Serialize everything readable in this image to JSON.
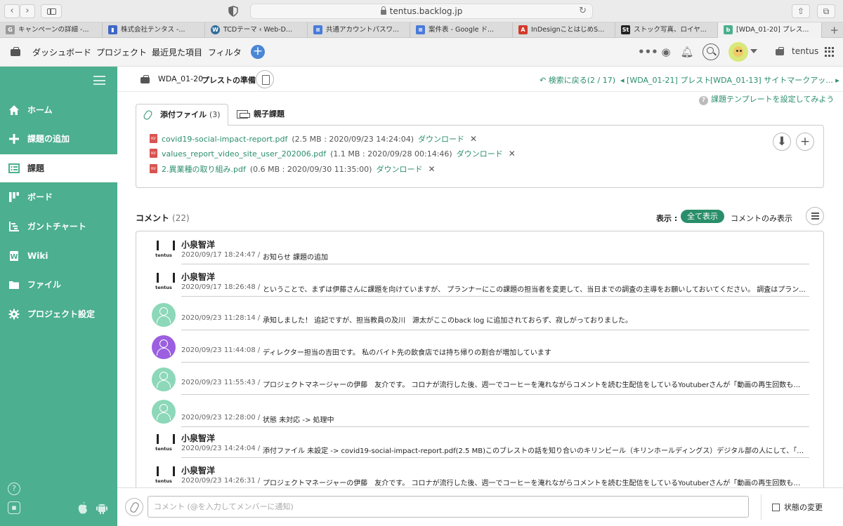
{
  "browser": {
    "url": "tentus.backlog.jp",
    "tabs": [
      {
        "label": "キャンペーンの詳細 -...",
        "fav": "G",
        "fav_color": "#9a9a9a"
      },
      {
        "label": "株式会社テンタス -...",
        "fav": "▮",
        "fav_color": "#3f67c5"
      },
      {
        "label": "TCDテーマ ‹ Web-D...",
        "fav": "W",
        "fav_color": "#2f6d9c"
      },
      {
        "label": "共通アカウントパスワ...",
        "fav": "≡",
        "fav_color": "#4a7bd9"
      },
      {
        "label": "案件表 - Google ド...",
        "fav": "≡",
        "fav_color": "#4a7bd9"
      },
      {
        "label": "InDesignことはじめS...",
        "fav": "A",
        "fav_color": "#d23a2a"
      },
      {
        "label": "ストック写真、ロイヤ...",
        "fav": "St",
        "fav_color": "#222222"
      },
      {
        "label": "[WDA_01-20] プレス...",
        "fav": "b",
        "fav_color": "#4caf8f"
      }
    ]
  },
  "header": {
    "links": [
      "ダッシュボード",
      "プロジェクト",
      "最近見た項目",
      "フィルタ"
    ],
    "space_name": "tentus"
  },
  "sidebar": {
    "items": [
      {
        "label": "ホーム",
        "icon": "home-icon"
      },
      {
        "label": "課題の追加",
        "icon": "plus-icon"
      },
      {
        "label": "課題",
        "icon": "list-icon"
      },
      {
        "label": "ボード",
        "icon": "board-icon"
      },
      {
        "label": "ガントチャート",
        "icon": "gantt-icon"
      },
      {
        "label": "Wiki",
        "icon": "wiki-icon"
      },
      {
        "label": "ファイル",
        "icon": "folder-icon"
      },
      {
        "label": "プロジェクト設定",
        "icon": "gear-icon"
      }
    ]
  },
  "issue": {
    "key": "WDA_01-20",
    "title": "プレストの準備",
    "back_to_search": "検索に戻る(2 / 17)",
    "prev_issue": "[WDA_01-21] プレスト",
    "next_issue": "[WDA_01-13] サイトマークアッ...",
    "template_hint": "課題テンプレートを設定してみよう"
  },
  "attachments": {
    "tab_label": "添付ファイル",
    "count": "(3)",
    "parent_tab_label": "親子課題",
    "download_label": "ダウンロード",
    "files": [
      {
        "name": "covid19-social-impact-report.pdf",
        "meta": "(2.5 MB : 2020/09/23 14:24:04)"
      },
      {
        "name": "values_report_video_site_user_202006.pdf",
        "meta": "(1.1 MB : 2020/09/28 00:14:46)"
      },
      {
        "name": "2.異業種の取り組み.pdf",
        "meta": "(0.6 MB : 2020/09/30 11:35:00)"
      }
    ]
  },
  "comments": {
    "heading": "コメント",
    "count": "(22)",
    "display_label": "表示 :",
    "filter_all": "全て表示",
    "filter_comments_only": "コメントのみ表示",
    "items": [
      {
        "author": "小泉智洋",
        "avatar": "tentus",
        "meta": "2020/09/17 18:24:47  /",
        "text": "お知らせ 課題の追加"
      },
      {
        "author": "小泉智洋",
        "avatar": "tentus",
        "meta": "2020/09/17 18:26:48  /",
        "text": "ということで、まずは伊藤さんに課題を向けていますが、 プランナーにこの課題の担当者を変更して、当日までの調査の主導をお願いしておいてください。 調査はプラン..."
      },
      {
        "author": "",
        "avatar": "green",
        "meta": "2020/09/23 11:28:14  /",
        "text": "承知しました！ 追記ですが、担当教員の及川　源太がここのback log に追加されておらず、寂しがっておりました。"
      },
      {
        "author": "",
        "avatar": "purple",
        "meta": "2020/09/23 11:44:08  /",
        "text": "ディレクター担当の吉田です。 私のバイト先の飲食店では持ち帰りの割合が増加しています"
      },
      {
        "author": "",
        "avatar": "green",
        "meta": "2020/09/23 11:55:43  /",
        "text": "プロジェクトマネージャーの伊藤　友介です。 コロナが流行した後、週一でコーヒーを淹れながらコメントを読む生配信をしているYoutuberさんが「動画の再生回数も伸..."
      },
      {
        "author": "",
        "avatar": "green",
        "meta": "2020/09/23 12:28:00  /",
        "text": "状態 未対応 -> 処理中"
      },
      {
        "author": "小泉智洋",
        "avatar": "tentus",
        "meta": "2020/09/23 14:24:04  /",
        "text": "添付ファイル 未設定 -> covid19-social-impact-report.pdf(2.5 MB)このブレストの話を知り合いのキリンビール（キリンホールディングス）デジタル部の人にして、「なん..."
      },
      {
        "author": "小泉智洋",
        "avatar": "tentus",
        "meta": "2020/09/23 14:26:31  /",
        "text": "プロジェクトマネージャーの伊藤　友介です。 コロナが流行した後、週一でコーヒーを淹れながらコメントを読む生配信をしているYoutuberさんが「動画の再生回数も伸..."
      }
    ]
  },
  "composer": {
    "placeholder": "コメント (@を入力してメンバーに通知)",
    "status_change": "状態の変更"
  }
}
